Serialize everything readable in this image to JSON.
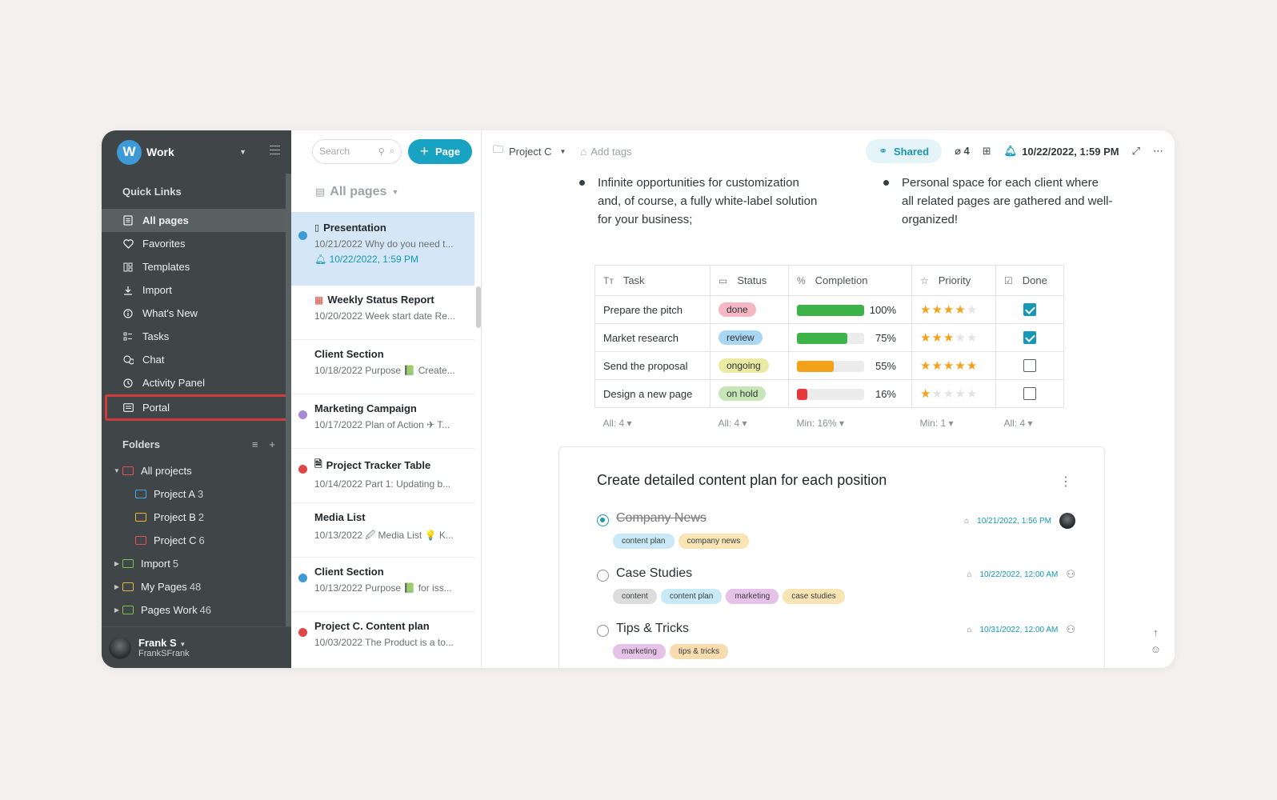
{
  "workspace": {
    "initial": "W",
    "name": "Work"
  },
  "quick_links": {
    "title": "Quick Links",
    "items": [
      {
        "label": "All pages",
        "icon": "pages-icon"
      },
      {
        "label": "Favorites",
        "icon": "heart-icon"
      },
      {
        "label": "Templates",
        "icon": "templates-icon"
      },
      {
        "label": "Import",
        "icon": "import-icon"
      },
      {
        "label": "What's New",
        "icon": "info-icon"
      },
      {
        "label": "Tasks",
        "icon": "tasks-icon"
      },
      {
        "label": "Chat",
        "icon": "chat-icon"
      },
      {
        "label": "Activity Panel",
        "icon": "clock-icon"
      },
      {
        "label": "Portal",
        "icon": "portal-icon"
      }
    ]
  },
  "folders": {
    "title": "Folders",
    "items": [
      {
        "label": "All projects",
        "count": ""
      },
      {
        "label": "Project A",
        "count": "3"
      },
      {
        "label": "Project B",
        "count": "2"
      },
      {
        "label": "Project C",
        "count": "6"
      },
      {
        "label": "Import",
        "count": "5"
      },
      {
        "label": "My Pages",
        "count": "48"
      },
      {
        "label": "Pages Work",
        "count": "46"
      }
    ]
  },
  "user": {
    "name": "Frank S",
    "handle": "FrankSFrank"
  },
  "page_list": {
    "search_placeholder": "Search",
    "new_page_label": "Page",
    "filter_label": "All pages",
    "items": [
      {
        "title": "Presentation",
        "desc": "10/21/2022 Why do you need t...",
        "reminder": "10/22/2022, 1:59 PM",
        "dot": "#3d9ad6"
      },
      {
        "title": "Weekly Status Report",
        "desc": "10/20/2022 Week start date Re...",
        "dot": ""
      },
      {
        "title": "Client Section",
        "desc": "10/18/2022 Purpose 📗 Create...",
        "dot": ""
      },
      {
        "title": "Marketing Campaign",
        "desc": "10/17/2022 Plan of Action ✈ T...",
        "dot": "#a98bd4"
      },
      {
        "title": "Project Tracker Table",
        "desc": "10/14/2022 Part 1: Updating b...",
        "dot": "#e04848"
      },
      {
        "title": "Media List",
        "desc": "10/13/2022 🖉 Media List 💡 K...",
        "dot": ""
      },
      {
        "title": "Client Section",
        "desc": "10/13/2022 Purpose 📗 for iss...",
        "dot": "#3d9ad6"
      },
      {
        "title": "Project C. Content plan",
        "desc": "10/03/2022 The Product is a to...",
        "dot": "#e04848"
      }
    ]
  },
  "toolbar": {
    "breadcrumb": "Project C",
    "add_tags": "Add tags",
    "shared_label": "Shared",
    "attachments": "4",
    "reminder": "10/22/2022, 1:59 PM"
  },
  "bullets": [
    "Infinite opportunities for customization and, of course, a fully white-label solution for your business;",
    "Personal space for each client where all related pages are gathered and well-organized!"
  ],
  "table": {
    "headers": [
      "Task",
      "Status",
      "Completion",
      "Priority",
      "Done"
    ],
    "rows": [
      {
        "task": "Prepare the pitch",
        "status": "done",
        "status_bg": "#f4b7c3",
        "completion": 100,
        "pct": "100%",
        "bar": "#3db34a",
        "priority": 4,
        "done": true
      },
      {
        "task": "Market research",
        "status": "review",
        "status_bg": "#a9d6f2",
        "completion": 75,
        "pct": "75%",
        "bar": "#3db34a",
        "priority": 3,
        "done": true
      },
      {
        "task": "Send the proposal",
        "status": "ongoing",
        "status_bg": "#eaeaa3",
        "completion": 55,
        "pct": "55%",
        "bar": "#f5a21b",
        "priority": 5,
        "done": false
      },
      {
        "task": "Design a new page",
        "status": "on hold",
        "status_bg": "#c7e6b7",
        "completion": 16,
        "pct": "16%",
        "bar": "#e5393b",
        "priority": 1,
        "done": false
      }
    ],
    "footer": [
      "All: 4",
      "All: 4",
      "Min: 16%",
      "Min: 1",
      "All: 4"
    ]
  },
  "checklist": {
    "title": "Create detailed content plan for each position",
    "items": [
      {
        "name": "Company News",
        "checked": true,
        "date": "10/21/2022, 1:56 PM",
        "tags": [
          {
            "label": "content plan",
            "bg": "#c9e9f6"
          },
          {
            "label": "company news",
            "bg": "#f9e4b4"
          }
        ]
      },
      {
        "name": "Case Studies",
        "checked": false,
        "date": "10/22/2022, 12:00 AM",
        "tags": [
          {
            "label": "content",
            "bg": "#dcdcdc"
          },
          {
            "label": "content plan",
            "bg": "#c9e9f6"
          },
          {
            "label": "marketing",
            "bg": "#e6c2e8"
          },
          {
            "label": "case studies",
            "bg": "#f9e4b4"
          }
        ]
      },
      {
        "name": "Tips & Tricks",
        "checked": false,
        "date": "10/31/2022, 12:00 AM",
        "tags": [
          {
            "label": "marketing",
            "bg": "#e6c2e8"
          },
          {
            "label": "tips & tricks",
            "bg": "#f9dbb0"
          }
        ]
      }
    ]
  },
  "colors": {
    "accent": "#18a3c2",
    "sidebar": "#404648",
    "highlight": "#d23b3b"
  }
}
